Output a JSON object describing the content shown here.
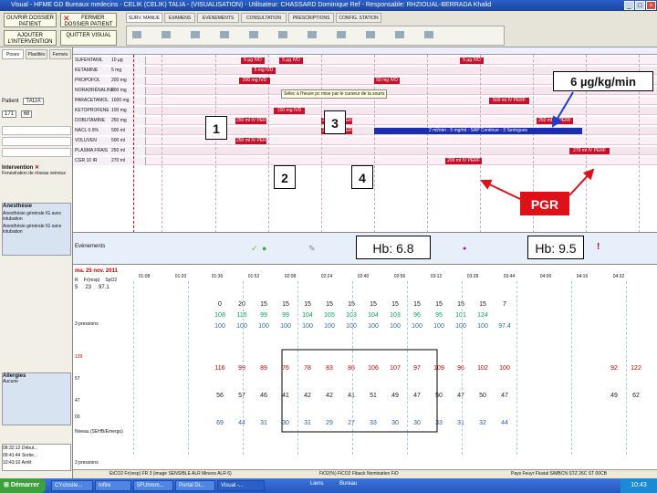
{
  "window": {
    "title": "Visual - HFME GD Bureaux medecins - CELIK (CELIK) TALIA - (VISUALISATION) - Utilisateur: CHASSARD Dominique Ref - Responsable: RHZIOUAL-BERRADA Khalid"
  },
  "toolbar": {
    "btn_open": "OUVRIR DOSSIER PATIENT",
    "btn_close": "FERMER DOSSIER PATIENT",
    "btn_intervention": "AJOUTER L'INTERVENTION",
    "btn_quit": "QUITTER VISUAL",
    "tabs": [
      "SURV. MANUE",
      "EXAMENS",
      "EVENEMENTS",
      "CONSULTATION",
      "PRESCRIPTIONS",
      "CONFIG. STATION"
    ]
  },
  "left": {
    "tabs": [
      "Poses",
      "Planifiés",
      "Fermés"
    ],
    "patient_label": "Patient",
    "patient_name": "TALIA",
    "weight": "68",
    "height": "171",
    "intervention_label": "Intervention",
    "intervention_text": "Fenestration de réseau veineux",
    "anesthesia_label": "Anesthésie",
    "anesthesia_text": "Anesthésie générale IG avec intubation",
    "anesthesia_text2": "Anesthésie générale IG sans intubation",
    "allergies_label": "Allergies",
    "allergies_text": "Aucune",
    "log": [
      "08:32:12 Début...",
      "09:41:44 Sortie...",
      "10:43:10 Arrêt"
    ]
  },
  "drugs": [
    {
      "name": "SUFENTANIL",
      "dose": "10 µg"
    },
    {
      "name": "KETAMINE",
      "dose": "5 mg"
    },
    {
      "name": "PROPOFOL",
      "dose": "200 mg"
    },
    {
      "name": "NORADRÉNALINE",
      "dose": "200 mg"
    },
    {
      "name": "PARACETAMOL",
      "dose": "1000 mg"
    },
    {
      "name": "KETOPROFENE",
      "dose": "100 mg"
    },
    {
      "name": "DOBUTAMINE",
      "dose": "250 mg"
    },
    {
      "name": "NACL 0.9%",
      "dose": "500 ml"
    },
    {
      "name": "VOLUVEN",
      "dose": "500 ml"
    },
    {
      "name": "PLASMA FRAIS",
      "dose": "250 ml"
    },
    {
      "name": "CGR 10 IR",
      "dose": "270 ml"
    }
  ],
  "marks": {
    "m1": "5 µg IVD",
    "m2": "5 µg IVD",
    "m3": "5 µg IVD",
    "m4": "5 mg IVD",
    "m5": "200 mg IVD",
    "m6": "50 mg IVD",
    "m7": "500 ml IV PERF",
    "m8": "100 mg IVD",
    "m9": "250 ml IV PERF",
    "m10": "250 ml IV PERF",
    "m11": "250 ml IV PERF",
    "m12": "250 ml IV PERF",
    "m13": "250 ml IV PERF",
    "m14": "2 ml/min - 5 mg/ml - SAP Continue - 3 Seringues",
    "m15": "200 ml IV PERF",
    "m16": "270 ml IV PERF"
  },
  "tooltip": "Sélec à l'heure pc mise par le curseur de la souris",
  "annotations": {
    "n1": "1",
    "n2": "2",
    "n3": "3",
    "n4": "4",
    "rate": "6 µg/kg/min",
    "pgr": "PGR",
    "hb1": "Hb: 6.8",
    "hb2": "Hb: 9.5"
  },
  "events_label": "Evènements",
  "date_label": "ma. 25 nov. 2011",
  "times": [
    "01:08",
    "01:20",
    "01:36",
    "01:52",
    "02:08",
    "02:24",
    "02:40",
    "02:56",
    "03:12",
    "03:28",
    "03:44",
    "04:00",
    "04:16",
    "04:32"
  ],
  "vitals_header": [
    "R",
    "Fr(resp)",
    "SpO2"
  ],
  "vitals_values": [
    "5",
    "23",
    "97.1"
  ],
  "spo2_row": [
    "0",
    "20",
    "15",
    "15",
    "15",
    "15",
    "15",
    "15",
    "15",
    "15",
    "15",
    "15",
    "15",
    "7"
  ],
  "fr_row": [
    "108",
    "115",
    "99",
    "99",
    "104",
    "105",
    "103",
    "104",
    "103",
    "96",
    "95",
    "101",
    "124",
    ""
  ],
  "row3": [
    "100",
    "100",
    "100",
    "100",
    "100",
    "100",
    "100",
    "100",
    "100",
    "100",
    "100",
    "100",
    "100",
    "97.4"
  ],
  "hr_row": [
    "116",
    "99",
    "89",
    "76",
    "78",
    "83",
    "86",
    "106",
    "107",
    "97",
    "109",
    "96",
    "102",
    "100"
  ],
  "pas_row": [
    "56",
    "57",
    "46",
    "41",
    "42",
    "42",
    "41",
    "51",
    "49",
    "47",
    "50",
    "47",
    "50",
    "47"
  ],
  "pad_row": [
    "69",
    "44",
    "31",
    "30",
    "31",
    "29",
    "27",
    "33",
    "30",
    "30",
    "33",
    "31",
    "32",
    "44"
  ],
  "hr_extra": [
    "92",
    "122"
  ],
  "pas_extra": [
    "49",
    "62"
  ],
  "axis_labels": [
    "139",
    "57",
    "47",
    "00"
  ],
  "monitor_label": "Niveau (SEHB/Emergo)",
  "pressions_label": "3 pressions",
  "pressions_label2": "3 pressions",
  "status": {
    "left": "EtCO2 Fr(resp) FR 3 (image SENSIBLE ALR Miness ALR 6)",
    "mid": "FiO2(%) FiCO2 Fiback Nomination FiO",
    "right": "Pays Feuyr Fluvial SIMBCN STZ 26C ST 00CB"
  },
  "taskbar": {
    "start": "Démarrer",
    "tasks": [
      "CYclosite...",
      "Infire",
      "5FUhmm...",
      "Portal Di...",
      "Visual -..."
    ],
    "right": [
      "Liens",
      "Bureau"
    ],
    "clock": "10:43"
  }
}
